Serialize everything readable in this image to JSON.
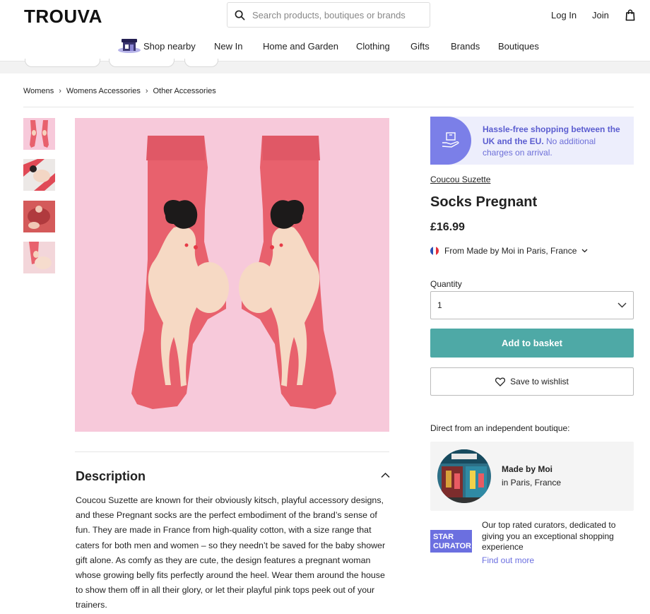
{
  "header": {
    "logo": "TROUVA",
    "search_placeholder": "Search products, boutiques or brands",
    "login": "Log In",
    "join": "Join"
  },
  "nav": [
    "Shop nearby",
    "New In",
    "Home and Garden",
    "Clothing",
    "Gifts",
    "Brands",
    "Boutiques"
  ],
  "breadcrumb": [
    "Womens",
    "Womens Accessories",
    "Other Accessories"
  ],
  "banner": {
    "bold": "Hassle-free shopping between the UK and the EU.",
    "rest": " No additional charges on arrival."
  },
  "product": {
    "brand": "Coucou Suzette",
    "title": "Socks Pregnant",
    "price": "£16.99",
    "from": "From Made by Moi in Paris, France",
    "quantity_label": "Quantity",
    "quantity_value": "1",
    "add_to_basket": "Add to basket",
    "save_wishlist": "Save to wishlist"
  },
  "boutique": {
    "heading": "Direct from an independent boutique:",
    "name": "Made by Moi",
    "location": "in Paris, France"
  },
  "curator": {
    "badge_line1": "STAR",
    "badge_line2": "CURATOR",
    "text": "Our top rated curators, dedicated to giving you an exceptional shopping experience",
    "link": "Find out more"
  },
  "description": {
    "title": "Description",
    "text": "Coucou Suzette are known for their obviously kitsch, playful accessory designs, and these Pregnant socks are the perfect embodiment of the brand’s sense of fun. They are made in France from high-quality cotton, with a size range that caters for both men and women – so they needn’t be saved for the baby shower gift alone. As comfy as they are cute, the design features a pregnant woman whose growing belly fits perfectly around the heel. Wear them around the house to show them off in all their glory, or let their playful pink tops peek out of your trainers."
  },
  "colors": {
    "accent": "#6b6fe0",
    "basket_button": "#4ea9a6",
    "banner_bg": "#edeefc",
    "image_bg": "#f7c9da",
    "sock": "#e8616d"
  }
}
